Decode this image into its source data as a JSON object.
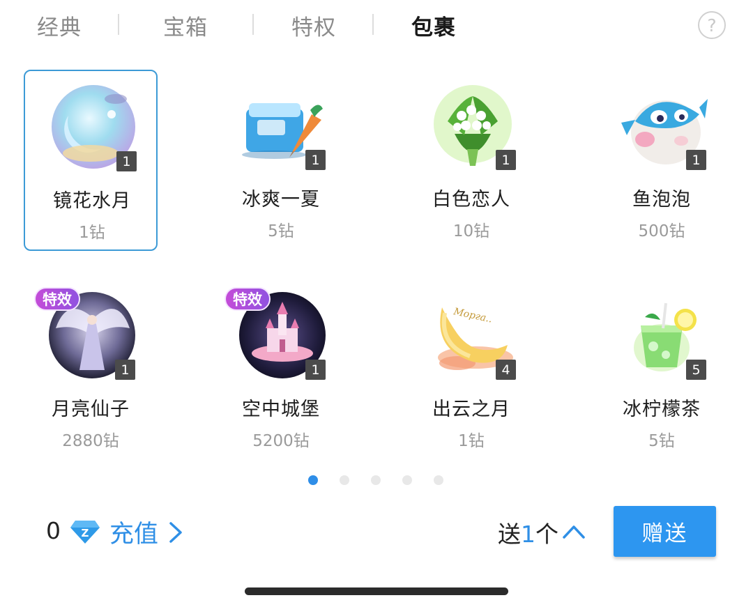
{
  "tabs": [
    {
      "label": "经典"
    },
    {
      "label": "宝箱"
    },
    {
      "label": "特权"
    },
    {
      "label": "包裹"
    }
  ],
  "active_tab": "包裹",
  "help_icon": "question-circle-icon",
  "gifts": [
    {
      "name": "镜花水月",
      "price": "1钻",
      "count": "1",
      "selected": true,
      "icon": "moon-orb-icon"
    },
    {
      "name": "冰爽一夏",
      "price": "5钻",
      "count": "1",
      "icon": "ice-cooler-icon"
    },
    {
      "name": "白色恋人",
      "price": "10钻",
      "count": "1",
      "icon": "flower-bouquet-icon"
    },
    {
      "name": "鱼泡泡",
      "price": "500钻",
      "count": "1",
      "icon": "puffer-fish-icon"
    },
    {
      "name": "月亮仙子",
      "price": "2880钻",
      "count": "1",
      "badge": "特效",
      "icon": "moon-fairy-icon"
    },
    {
      "name": "空中城堡",
      "price": "5200钻",
      "count": "1",
      "badge": "特效",
      "icon": "sky-castle-icon"
    },
    {
      "name": "出云之月",
      "price": "1钻",
      "count": "4",
      "icon": "crescent-moon-icon",
      "moon_text": "Морга.."
    },
    {
      "name": "冰柠檬茶",
      "price": "5钻",
      "count": "5",
      "icon": "lemon-tea-icon"
    }
  ],
  "pagination": {
    "pages": 5,
    "current": 1
  },
  "balance": {
    "amount": "0",
    "icon": "diamond-icon"
  },
  "recharge": {
    "label": "充值"
  },
  "send": {
    "prefix": "送",
    "quantity": "1",
    "suffix": "个"
  },
  "send_button": {
    "label": "赠送"
  },
  "colors": {
    "accent": "#2d96f0",
    "selected_border": "#3c9ad6",
    "badge_purple": "#b04fdc"
  }
}
